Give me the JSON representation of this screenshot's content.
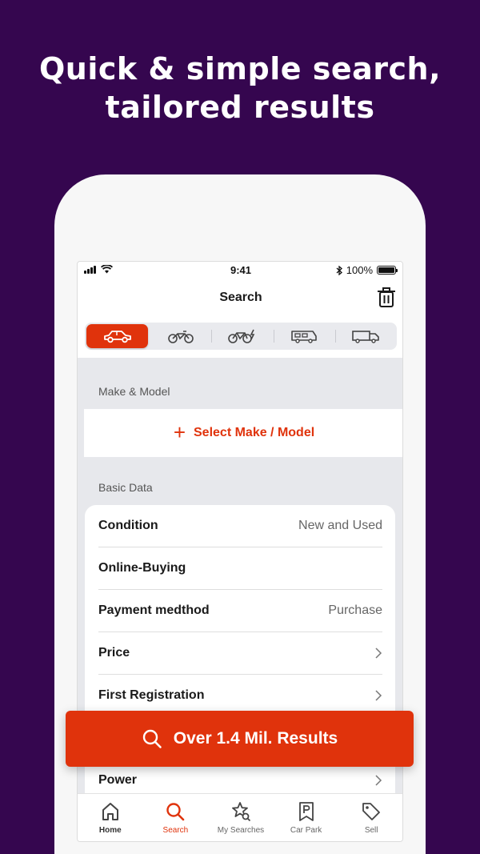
{
  "headline": {
    "line1": "Quick & simple search,",
    "line2": "tailored results"
  },
  "status_bar": {
    "time": "9:41",
    "battery": "100%"
  },
  "nav": {
    "title": "Search"
  },
  "vehicle_types": [
    {
      "name": "car-icon",
      "active": true
    },
    {
      "name": "motorbike-icon",
      "active": false
    },
    {
      "name": "ebike-icon",
      "active": false
    },
    {
      "name": "motorhome-icon",
      "active": false
    },
    {
      "name": "truck-icon",
      "active": false
    }
  ],
  "make_model": {
    "section_label": "Make & Model",
    "select_label": "Select Make / Model"
  },
  "basic_data": {
    "section_label": "Basic Data",
    "rows": [
      {
        "label": "Condition",
        "value": "New and Used"
      },
      {
        "label": "Online-Buying",
        "value": ""
      },
      {
        "label": "Payment medthod",
        "value": "Purchase"
      },
      {
        "label": "Price",
        "value": ""
      },
      {
        "label": "First Registration",
        "value": ""
      },
      {
        "label": "Power",
        "value": ""
      }
    ]
  },
  "results_button": {
    "label": "Over 1.4 Mil. Results"
  },
  "tabbar": {
    "items": [
      {
        "label": "Home",
        "icon": "home-icon"
      },
      {
        "label": "Search",
        "icon": "search-icon",
        "active": true
      },
      {
        "label": "My Searches",
        "icon": "saved-search-icon"
      },
      {
        "label": "Car Park",
        "icon": "car-park-icon"
      },
      {
        "label": "Sell",
        "icon": "tag-icon"
      }
    ]
  },
  "colors": {
    "background": "#35064f",
    "accent": "#e0330c"
  }
}
